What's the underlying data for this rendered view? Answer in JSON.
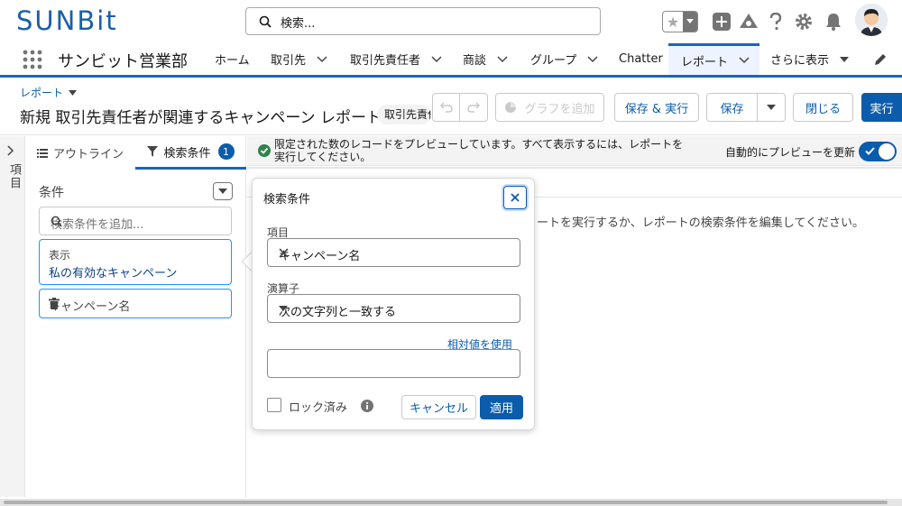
{
  "header": {
    "logo": "SUNBit",
    "search_placeholder": "検索..."
  },
  "nav": {
    "app_name": "サンビット営業部",
    "items": [
      {
        "label": "ホーム"
      },
      {
        "label": "取引先"
      },
      {
        "label": "取引先責任者"
      },
      {
        "label": "商談"
      },
      {
        "label": "グループ"
      },
      {
        "label": "Chatter"
      },
      {
        "label": "レポート"
      },
      {
        "label": "さらに表示"
      }
    ]
  },
  "report": {
    "breadcrumb": "レポート",
    "title": "新規 取引先責任者が関連するキャンペーン レポート",
    "type_badge": "取引先責任者が関連するキャンペーン",
    "buttons": {
      "add_chart": "グラフを追加",
      "save_and_run": "保存 & 実行",
      "save": "保存",
      "close": "閉じる",
      "run": "実行"
    }
  },
  "left_rail": {
    "label": "項目"
  },
  "filters_panel": {
    "tab_outline": "アウトライン",
    "tab_filters": "検索条件",
    "filter_count": "1",
    "conditions_title": "条件",
    "add_filter_placeholder": "検索条件を追加...",
    "show_filter": {
      "key": "表示",
      "value": "私の有効なキャンペーン"
    },
    "campaign_filter": "キャンペーン名"
  },
  "preview": {
    "message": "限定された数のレコードをプレビューしています。すべて表示するには、レポートを実行してください。",
    "auto_preview_label": "自動的にプレビューを更新",
    "empty_message": "ートを実行するか、レポートの検索条件を編集してください。"
  },
  "popover": {
    "title": "検索条件",
    "field_label": "項目",
    "field_value": "キャンペーン名",
    "operator_label": "演算子",
    "operator_value": "次の文字列と一致する",
    "relative_value_link": "相対値を使用",
    "value_input": "",
    "locked_label": "ロック済み",
    "cancel": "キャンセル",
    "apply": "適用"
  },
  "colors": {
    "brand": "#0b5cab",
    "nav_accent": "#1f63b4",
    "logo": "#1c5fa8",
    "success": "#2e844a"
  }
}
